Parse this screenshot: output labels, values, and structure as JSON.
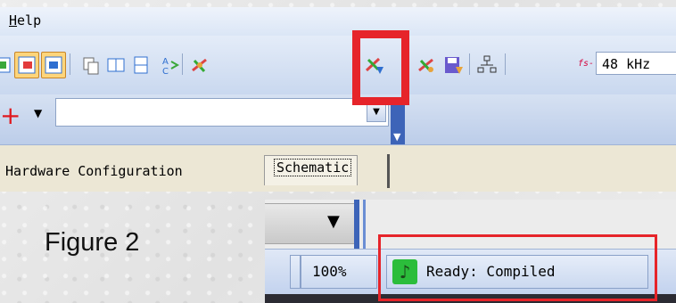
{
  "menu": {
    "help_label": "Help",
    "help_mnemonic": "H",
    "help_rest": "elp"
  },
  "toolbar": {
    "buttons": [
      {
        "icon": "layout-green-icon"
      },
      {
        "icon": "layout-red-icon"
      },
      {
        "icon": "layout-blue-icon"
      },
      {
        "icon": "copy-icon"
      },
      {
        "icon": "split-vertical-icon"
      },
      {
        "icon": "split-horizontal-icon"
      },
      {
        "icon": "font-az-icon"
      },
      {
        "icon": "link-compile-icon"
      },
      {
        "icon": "link-compile-download-icon"
      },
      {
        "icon": "link-compile-alt-icon"
      },
      {
        "icon": "save-download-icon"
      },
      {
        "icon": "hierarchy-icon"
      }
    ],
    "sample_rate_label": "fs-",
    "sample_rate_value": "48 kHz",
    "highlight_color": "#e6242a"
  },
  "row3": {
    "add_icon": "+",
    "dropdown_arrow": "▼",
    "overflow_arrow": "▼"
  },
  "tabs": [
    {
      "label": "Hardware Configuration",
      "selected": false
    },
    {
      "label": "Schematic",
      "selected": true
    }
  ],
  "figure_label": "Figure 2",
  "statusbar": {
    "dropdown_arrow": "▼",
    "zoom": "100%",
    "status_text": "Ready: Compiled",
    "status_icon": "music-note-icon",
    "status_icon_glyph": "♪"
  }
}
